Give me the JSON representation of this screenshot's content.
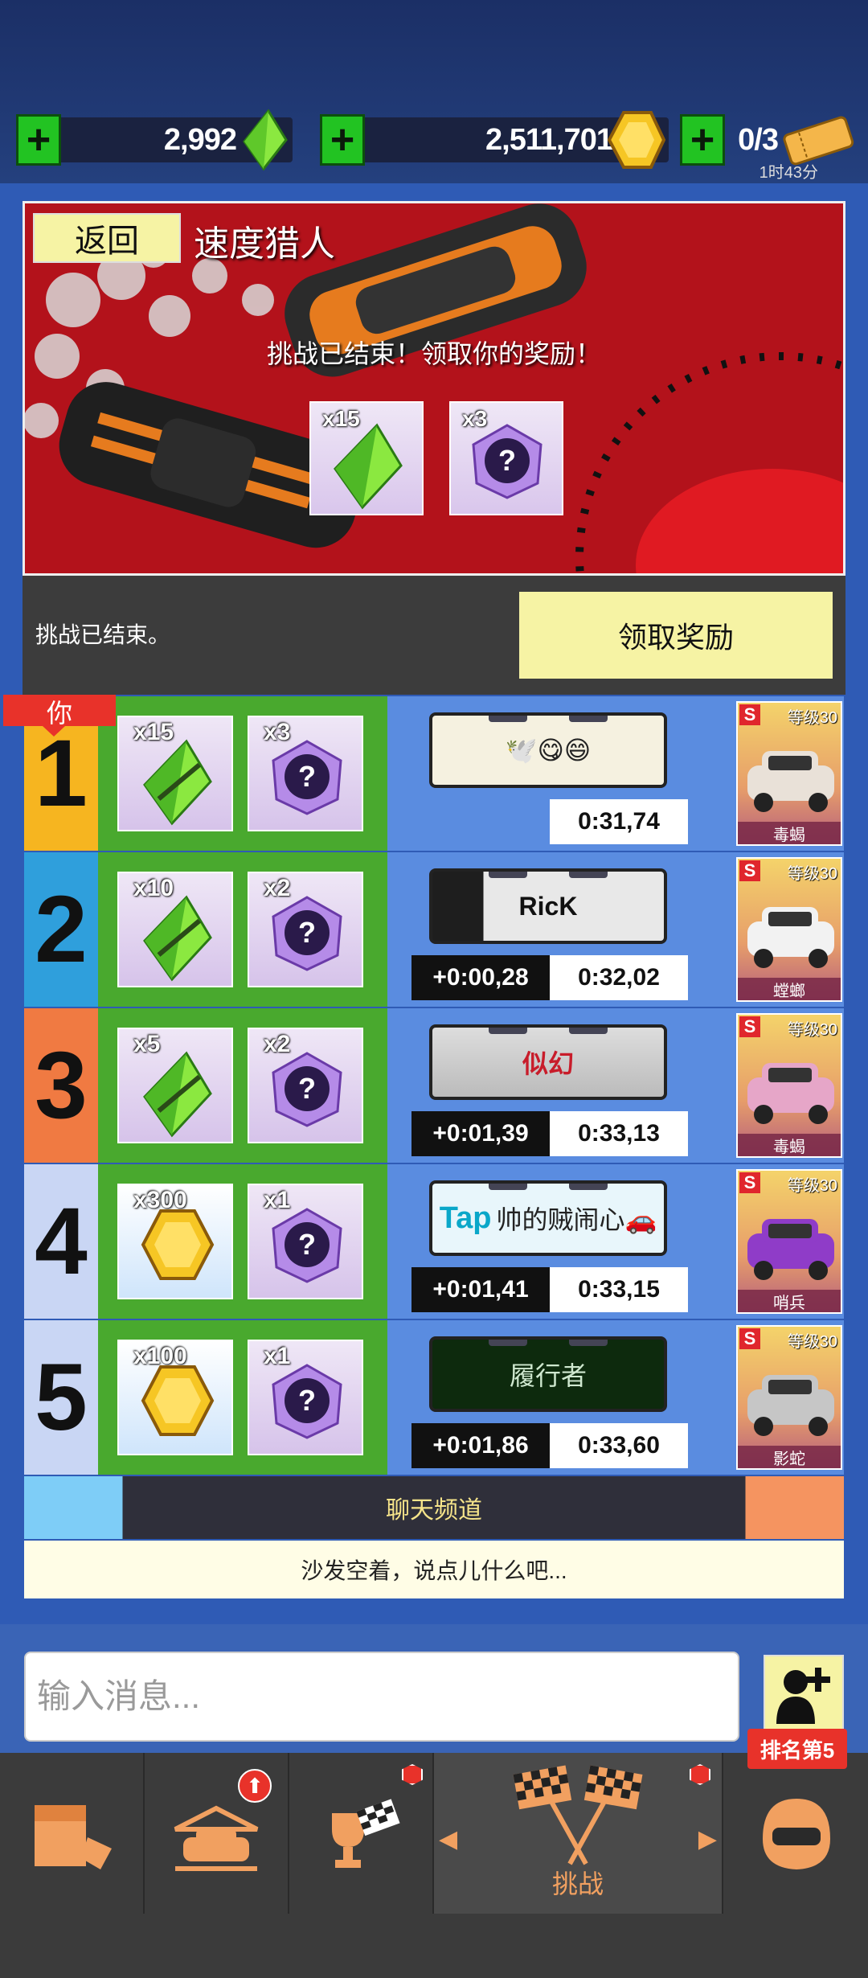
{
  "resources": {
    "gems": "2,992",
    "credits": "2,511,701",
    "tickets": "0/3",
    "ticket_timer": "1时43分"
  },
  "event": {
    "back_label": "返回",
    "title": "速度猎人",
    "message": "挑战已结束！领取你的奖励！",
    "rewards": [
      {
        "count": "x15",
        "icon": "gem-icon"
      },
      {
        "count": "x3",
        "icon": "mystery-box-icon"
      }
    ],
    "footer_text": "挑战已结束。",
    "claim_label": "领取奖励"
  },
  "leaderboard": {
    "you_label": "你",
    "rows": [
      {
        "rank": "1",
        "rank_color": "#f6b520",
        "r1_count": "x15",
        "r1_icon": "gem-icon",
        "r2_count": "x3",
        "r2_icon": "mystery-box-icon",
        "plate_text": "🕊️😋😄",
        "gap": "",
        "time": "0:31,74",
        "car_level": "等级30",
        "car_name": "毒蝎"
      },
      {
        "rank": "2",
        "rank_color": "#2f9fdc",
        "r1_count": "x10",
        "r1_icon": "gem-icon",
        "r2_count": "x2",
        "r2_icon": "mystery-box-icon",
        "plate_text": "RicK",
        "gap": "+0:00,28",
        "time": "0:32,02",
        "car_level": "等级30",
        "car_name": "螳螂"
      },
      {
        "rank": "3",
        "rank_color": "#f07a42",
        "r1_count": "x5",
        "r1_icon": "gem-icon",
        "r2_count": "x2",
        "r2_icon": "mystery-box-icon",
        "plate_text": "似幻",
        "gap": "+0:01,39",
        "time": "0:33,13",
        "car_level": "等级30",
        "car_name": "毒蝎"
      },
      {
        "rank": "4",
        "rank_color": "#c9d6f4",
        "r1_count": "x300",
        "r1_icon": "credits-icon",
        "r2_count": "x1",
        "r2_icon": "mystery-box-icon",
        "plate_text": "帅的贼闹心🚗",
        "plate_prefix": "Tap",
        "gap": "+0:01,41",
        "time": "0:33,15",
        "car_level": "等级30",
        "car_name": "哨兵"
      },
      {
        "rank": "5",
        "rank_color": "#c9d6f4",
        "r1_count": "x100",
        "r1_icon": "credits-icon",
        "r2_count": "x1",
        "r2_icon": "mystery-box-icon",
        "plate_text": "履行者",
        "gap": "+0:01,86",
        "time": "0:33,60",
        "car_level": "等级30",
        "car_name": "影蛇"
      }
    ]
  },
  "chat": {
    "header": "聊天频道",
    "empty_text": "沙发空着，说点儿什么吧...",
    "input_placeholder": "输入消息...",
    "rank_badge": "排名第5"
  },
  "nav": {
    "items": [
      {
        "name": "garage-shop",
        "icon": "crate-icon"
      },
      {
        "name": "car-upgrade",
        "icon": "car-upgrade-icon"
      },
      {
        "name": "cups",
        "icon": "trophy-flag-icon"
      },
      {
        "name": "challenge",
        "icon": "checkered-flags-icon",
        "label": "挑战"
      },
      {
        "name": "profile",
        "icon": "helmet-icon"
      }
    ]
  },
  "colors": {
    "accent_yellow": "#f6f3a4",
    "green": "#49a92e",
    "blue": "#5a8ce0",
    "red": "#e8322a"
  }
}
